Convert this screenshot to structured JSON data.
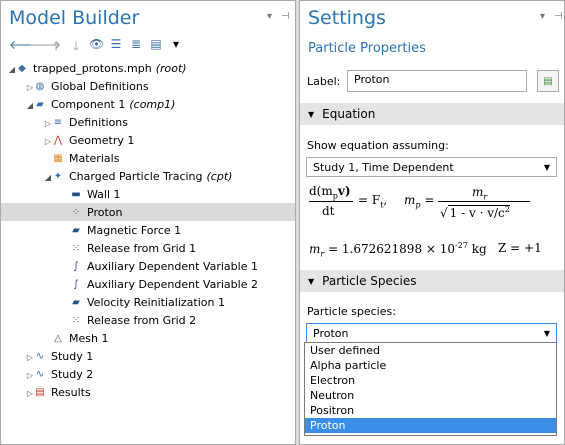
{
  "model_builder": {
    "title": "Model Builder",
    "tree": [
      {
        "depth": 0,
        "twisty": "open",
        "icon": "model-icon",
        "label": "trapped_protons.mph",
        "tag": "(root)"
      },
      {
        "depth": 1,
        "twisty": "closed",
        "icon": "globe-icon",
        "label": "Global Definitions",
        "tag": ""
      },
      {
        "depth": 1,
        "twisty": "open",
        "icon": "component-icon",
        "label": "Component 1",
        "tag": "(comp1)"
      },
      {
        "depth": 2,
        "twisty": "closed",
        "icon": "definitions-icon",
        "label": "Definitions",
        "tag": ""
      },
      {
        "depth": 2,
        "twisty": "closed",
        "icon": "geometry-icon",
        "label": "Geometry 1",
        "tag": ""
      },
      {
        "depth": 2,
        "twisty": "",
        "icon": "materials-icon",
        "label": "Materials",
        "tag": ""
      },
      {
        "depth": 2,
        "twisty": "open",
        "icon": "particle-tracing-icon",
        "label": "Charged Particle Tracing",
        "tag": "(cpt)"
      },
      {
        "depth": 3,
        "twisty": "",
        "icon": "wall-icon",
        "label": "Wall 1",
        "tag": ""
      },
      {
        "depth": 3,
        "twisty": "",
        "icon": "proton-icon",
        "label": "Proton",
        "tag": "",
        "selected": true
      },
      {
        "depth": 3,
        "twisty": "",
        "icon": "magnetic-force-icon",
        "label": "Magnetic Force 1",
        "tag": ""
      },
      {
        "depth": 3,
        "twisty": "",
        "icon": "release-grid-icon",
        "label": "Release from Grid 1",
        "tag": ""
      },
      {
        "depth": 3,
        "twisty": "",
        "icon": "aux-variable-icon",
        "label": "Auxiliary Dependent Variable 1",
        "tag": ""
      },
      {
        "depth": 3,
        "twisty": "",
        "icon": "aux-variable-icon",
        "label": "Auxiliary Dependent Variable 2",
        "tag": ""
      },
      {
        "depth": 3,
        "twisty": "",
        "icon": "velocity-reinit-icon",
        "label": "Velocity Reinitialization 1",
        "tag": ""
      },
      {
        "depth": 3,
        "twisty": "",
        "icon": "release-grid-icon",
        "label": "Release from Grid 2",
        "tag": ""
      },
      {
        "depth": 2,
        "twisty": "",
        "icon": "mesh-icon",
        "label": "Mesh 1",
        "tag": ""
      },
      {
        "depth": 1,
        "twisty": "closed",
        "icon": "study-icon",
        "label": "Study 1",
        "tag": ""
      },
      {
        "depth": 1,
        "twisty": "closed",
        "icon": "study-icon",
        "label": "Study 2",
        "tag": ""
      },
      {
        "depth": 1,
        "twisty": "closed",
        "icon": "results-icon",
        "label": "Results",
        "tag": ""
      }
    ]
  },
  "settings": {
    "title": "Settings",
    "subtitle": "Particle Properties",
    "label_caption": "Label:",
    "label_value": "Proton",
    "equation_section": "Equation",
    "show_equation_caption": "Show equation assuming:",
    "study_select": "Study 1, Time Dependent",
    "eq_lhs_num": "d(m",
    "eq_lhs_num_sub": "p",
    "eq_lhs_num_v": "v)",
    "eq_lhs_den": "dt",
    "eq_eq": "= F",
    "eq_eq_sub": "t",
    "eq_comma": ",",
    "eq_mp": "m",
    "eq_mp_sub": "p",
    "eq_mr": "m",
    "eq_mr_sub": "r",
    "eq_sqrt": "1 - v · v/c",
    "eq_sqrt_sup": "2",
    "mass_line": "= 1.672621898 × 10",
    "mass_exp": "-27",
    "mass_unit": "kg",
    "z_line": "Z = +1",
    "species_section": "Particle Species",
    "species_caption": "Particle species:",
    "species_selected": "Proton",
    "species_options": [
      "User defined",
      "Alpha particle",
      "Electron",
      "Neutron",
      "Positron",
      "Proton"
    ],
    "selected_option": "Proton"
  }
}
